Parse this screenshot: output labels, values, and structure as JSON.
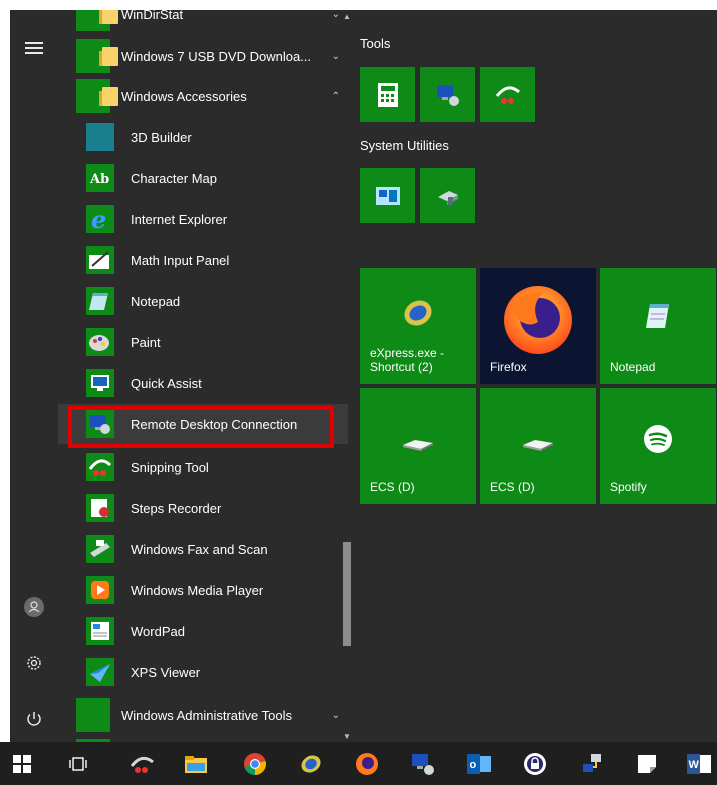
{
  "rail": {
    "menu_icon": "hamburger-icon",
    "user_icon": "user-icon",
    "settings_icon": "gear-icon",
    "power_icon": "power-icon"
  },
  "applist": {
    "top_partial": "WinDirStat",
    "folder_usb": "Windows 7 USB DVD Downloa...",
    "folder_accessories": "Windows Accessories",
    "apps": [
      {
        "label": "3D Builder",
        "icon": "3d-builder-icon"
      },
      {
        "label": "Character Map",
        "icon": "character-map-icon"
      },
      {
        "label": "Internet Explorer",
        "icon": "internet-explorer-icon"
      },
      {
        "label": "Math Input Panel",
        "icon": "math-input-icon"
      },
      {
        "label": "Notepad",
        "icon": "notepad-icon"
      },
      {
        "label": "Paint",
        "icon": "paint-icon"
      },
      {
        "label": "Quick Assist",
        "icon": "quick-assist-icon"
      },
      {
        "label": "Remote Desktop Connection",
        "icon": "remote-desktop-icon"
      },
      {
        "label": "Snipping Tool",
        "icon": "snipping-tool-icon"
      },
      {
        "label": "Steps Recorder",
        "icon": "steps-recorder-icon"
      },
      {
        "label": "Windows Fax and Scan",
        "icon": "fax-scan-icon"
      },
      {
        "label": "Windows Media Player",
        "icon": "media-player-icon"
      },
      {
        "label": "WordPad",
        "icon": "wordpad-icon"
      },
      {
        "label": "XPS Viewer",
        "icon": "xps-viewer-icon"
      }
    ],
    "folder_admin": "Windows Administrative Tools"
  },
  "tiles": {
    "group_tools": "Tools",
    "group_system": "System Utilities",
    "express_label": "eXpress.exe - Shortcut (2)",
    "firefox_label": "Firefox",
    "notepad_label": "Notepad",
    "ecs1_label": "ECS (D)",
    "ecs2_label": "ECS (D)",
    "spotify_label": "Spotify"
  },
  "colors": {
    "tile_green": "#0e8a16",
    "menu_bg": "#2b2b2b",
    "highlight_red": "#e00000"
  }
}
